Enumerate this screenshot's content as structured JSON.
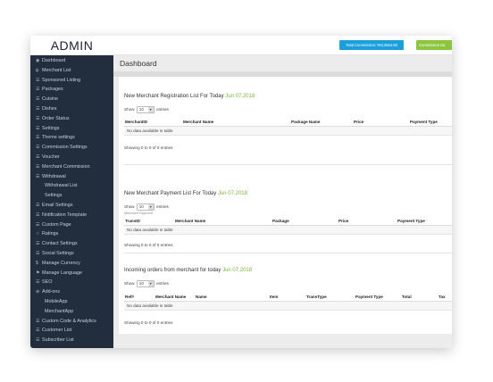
{
  "header": {
    "brand": "ADMIN",
    "total_commission_label": "Total Commission: Rs12564.60",
    "commission_button_label": "Commission Ea"
  },
  "sidebar": {
    "items": [
      {
        "label": "Dashboard",
        "icon": "tachometer-icon",
        "glyph": "◉",
        "sub": false
      },
      {
        "label": "Merchant List",
        "icon": "merchant-icon",
        "glyph": "ψ",
        "sub": false
      },
      {
        "label": "Sponsored Listing",
        "icon": "list-icon",
        "glyph": "☰",
        "sub": false
      },
      {
        "label": "Packages",
        "icon": "list-icon",
        "glyph": "☰",
        "sub": false
      },
      {
        "label": "Cuisine",
        "icon": "list-icon",
        "glyph": "☰",
        "sub": false
      },
      {
        "label": "Dishes",
        "icon": "list-icon",
        "glyph": "☰",
        "sub": false
      },
      {
        "label": "Order Status",
        "icon": "list-icon",
        "glyph": "☰",
        "sub": false
      },
      {
        "label": "Settings",
        "icon": "list-icon",
        "glyph": "☰",
        "sub": false
      },
      {
        "label": "Theme settings",
        "icon": "list-icon",
        "glyph": "☰",
        "sub": false
      },
      {
        "label": "Commission Settings",
        "icon": "list-icon",
        "glyph": "☰",
        "sub": false
      },
      {
        "label": "Voucher",
        "icon": "list-icon",
        "glyph": "☰",
        "sub": false
      },
      {
        "label": "Merchant Commission",
        "icon": "list-icon",
        "glyph": "☰",
        "sub": false
      },
      {
        "label": "Withdrawal",
        "icon": "list-icon",
        "glyph": "☰",
        "sub": false
      },
      {
        "label": "Withdrawal List",
        "icon": "",
        "glyph": "",
        "sub": true
      },
      {
        "label": "Settings",
        "icon": "",
        "glyph": "",
        "sub": true
      },
      {
        "label": "Email Settings",
        "icon": "list-icon",
        "glyph": "☰",
        "sub": false
      },
      {
        "label": "Notification Template",
        "icon": "list-icon",
        "glyph": "☰",
        "sub": false
      },
      {
        "label": "Custom Page",
        "icon": "list-icon",
        "glyph": "☰",
        "sub": false
      },
      {
        "label": "Ratings",
        "icon": "star-icon",
        "glyph": "☆",
        "sub": false
      },
      {
        "label": "Contact Settings",
        "icon": "list-icon",
        "glyph": "☰",
        "sub": false
      },
      {
        "label": "Social Settings",
        "icon": "list-icon",
        "glyph": "☰",
        "sub": false
      },
      {
        "label": "Manage Currency",
        "icon": "dollar-icon",
        "glyph": "$",
        "sub": false
      },
      {
        "label": "Manage Language",
        "icon": "flag-icon",
        "glyph": "⚑",
        "sub": false
      },
      {
        "label": "SEO",
        "icon": "list-icon",
        "glyph": "☰",
        "sub": false
      },
      {
        "label": "Add-ons",
        "icon": "plus-circle-icon",
        "glyph": "⊕",
        "sub": false
      },
      {
        "label": "MobileApp",
        "icon": "",
        "glyph": "",
        "sub": true
      },
      {
        "label": "MerchantApp",
        "icon": "",
        "glyph": "",
        "sub": true
      },
      {
        "label": "Custom Code & Analytics",
        "icon": "list-icon",
        "glyph": "☰",
        "sub": false
      },
      {
        "label": "Customer List",
        "icon": "list-icon",
        "glyph": "☰",
        "sub": false
      },
      {
        "label": "Subscriber List",
        "icon": "list-icon",
        "glyph": "☰",
        "sub": false
      }
    ]
  },
  "main": {
    "page_title": "Dashboard",
    "registration": {
      "title": "New Merchant Registration List For Today",
      "date": "Jun 07,2018",
      "show_label": "Show",
      "show_value": "10",
      "entries_label": "entries",
      "columns": [
        "MerchantID",
        "Merchant Name",
        "Package Name",
        "Price",
        "Payment Type"
      ],
      "empty": "No data available in table",
      "footer": "Showing 0 to 0 of 0 entries"
    },
    "payment": {
      "title": "New Merchant Payment List For Today",
      "date": "Jun 07,2018",
      "show_label": "Show",
      "show_value": "10",
      "entries_label": "entries",
      "caption": "Merchant Payment",
      "columns": [
        "TransID",
        "Merchant Name",
        "Package",
        "Price",
        "Payment Type"
      ],
      "empty": "No data available in table",
      "footer": "Showing 0 to 0 of 0 entries"
    },
    "orders": {
      "title": "Incoming orders from merchant for today",
      "date": "Jun 07,2018",
      "show_label": "Show",
      "show_value": "10",
      "entries_label": "entries",
      "columns": [
        "Ref#",
        "Merchant Name",
        "Name",
        "Item",
        "TransType",
        "Payment Type",
        "Total",
        "Tax"
      ],
      "empty": "No data available in table",
      "footer": "Showing 0 to 0 of 0 entries"
    }
  },
  "colors": {
    "sidebar_bg": "#222d3d",
    "total_button": "#1a9fdc",
    "commission_button": "#8cc63f",
    "date_accent": "#7ab33a"
  }
}
